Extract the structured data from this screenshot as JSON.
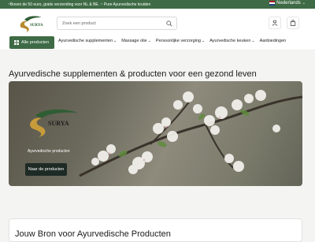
{
  "topbar": {
    "promo": "~Boven de 50 euro, gratis verzending voor NL & BE. ~ Pure Ayurvedische kruiden",
    "language": "Nederlands"
  },
  "header": {
    "search_placeholder": "Zoek een product"
  },
  "nav": {
    "all_products": "Alle producten",
    "items": [
      {
        "label": "Ayurvedische supplementen",
        "dropdown": true
      },
      {
        "label": "Massage olie",
        "dropdown": true
      },
      {
        "label": "Persoonlijke verzorging",
        "dropdown": true
      },
      {
        "label": "Ayurvedische keuken",
        "dropdown": true
      },
      {
        "label": "Aanbiedingen",
        "dropdown": false
      }
    ]
  },
  "main": {
    "heading": "Ayurvedische supplementen & producten voor een gezond leven",
    "hero": {
      "caption": "Ayurvedische producten",
      "button": "Naar de producten",
      "logo_text": "SURYA"
    },
    "section_heading": "Jouw Bron voor Ayurvedische Producten"
  },
  "colors": {
    "brand_green": "#3e6b45",
    "button_dark": "#1e2a25"
  }
}
